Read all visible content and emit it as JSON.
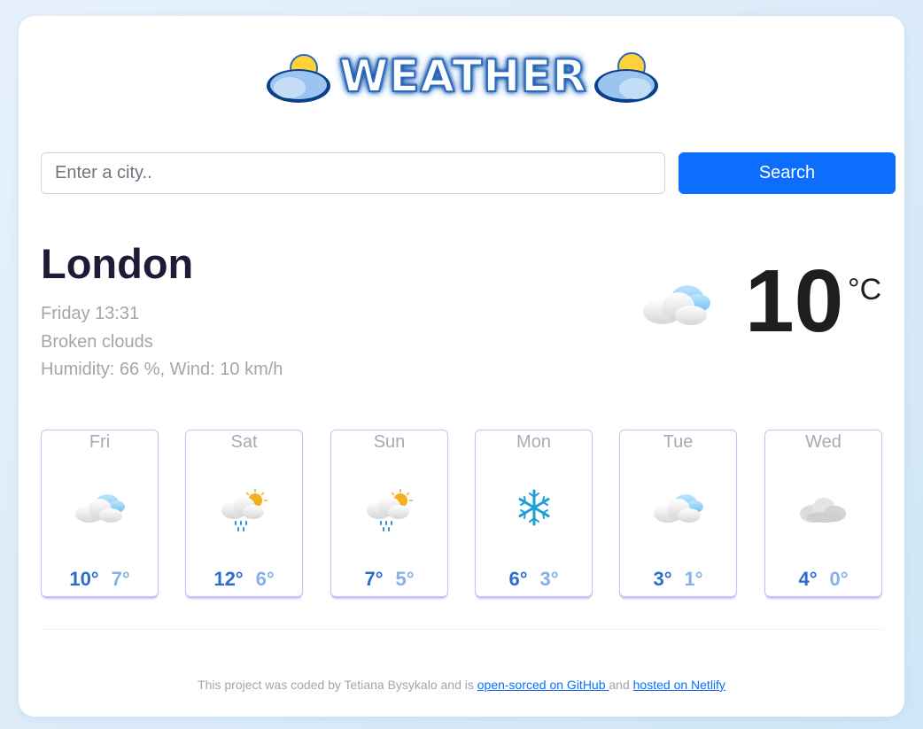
{
  "logo": {
    "text": "WEATHER"
  },
  "search": {
    "placeholder": "Enter a city..",
    "button_label": "Search"
  },
  "current": {
    "city": "London",
    "datetime": "Friday 13:31",
    "description": "Broken clouds",
    "humidity_wind": "Humidity: 66 %, Wind: 10 km/h",
    "temperature": "10",
    "unit": "°C",
    "icon": "cloud-icon"
  },
  "forecast": [
    {
      "day": "Fri",
      "max": "10°",
      "min": "7°",
      "icon": "cloud-icon"
    },
    {
      "day": "Sat",
      "max": "12°",
      "min": "6°",
      "icon": "sun-rain-icon"
    },
    {
      "day": "Sun",
      "max": "7°",
      "min": "5°",
      "icon": "sun-rain-icon"
    },
    {
      "day": "Mon",
      "max": "6°",
      "min": "3°",
      "icon": "snowflake-icon"
    },
    {
      "day": "Tue",
      "max": "3°",
      "min": "1°",
      "icon": "cloud-icon"
    },
    {
      "day": "Wed",
      "max": "4°",
      "min": "0°",
      "icon": "grey-cloud-icon"
    }
  ],
  "footer": {
    "text_before": "This project was coded by Tetiana Bysykalo and is ",
    "link_github": "open-sorced on GitHub ",
    "text_middle": "and ",
    "link_netlify": "hosted on Netlify"
  },
  "colors": {
    "accent": "#0d6efd",
    "max_temp": "#2b6cd1",
    "min_temp": "#86b0e8"
  }
}
